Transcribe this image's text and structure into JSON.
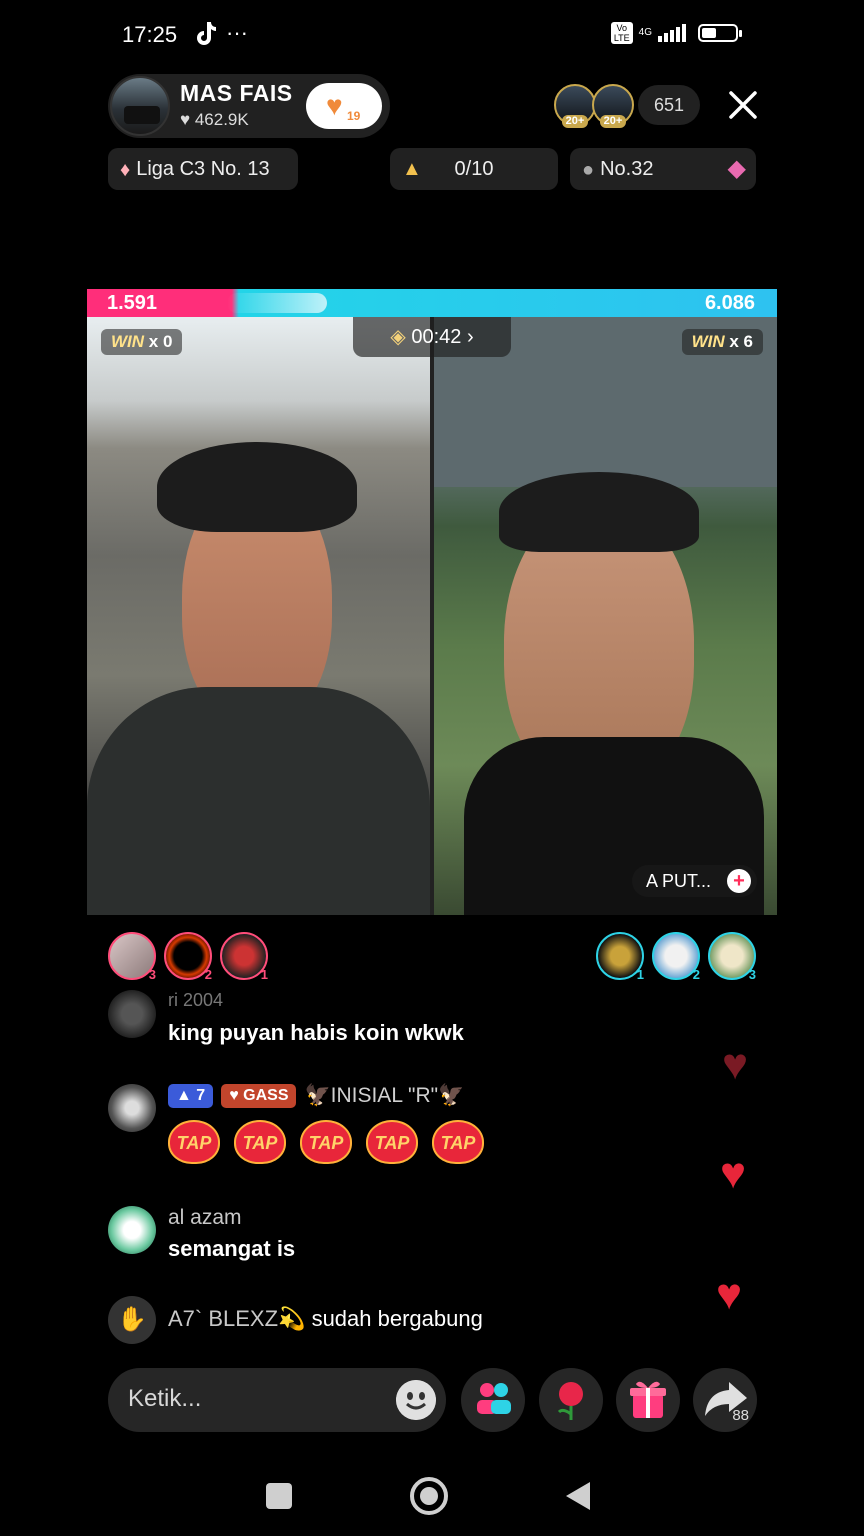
{
  "status_bar": {
    "time": "17:25",
    "more": "···",
    "network": "4G"
  },
  "host": {
    "name": "MAS FAIS",
    "likes": "462.9K",
    "fan_badge_count": "19"
  },
  "viewers": {
    "count": "651",
    "badges": [
      "20+",
      "20+"
    ]
  },
  "badges": {
    "league": "Liga C3 No. 13",
    "goal": "0/10",
    "rank": "No.32"
  },
  "battle": {
    "left_score": "1.591",
    "right_score": "6.086",
    "left_win_label": "WIN",
    "left_win_count": "x 0",
    "right_win_label": "WIN",
    "right_win_count": "x 6",
    "timer": "00:42",
    "guest_name": "A PUT..."
  },
  "gifters": {
    "left": [
      {
        "rank": "3"
      },
      {
        "rank": "2"
      },
      {
        "rank": "1"
      }
    ],
    "right": [
      {
        "rank": "1"
      },
      {
        "rank": "2"
      },
      {
        "rank": "3"
      }
    ]
  },
  "chat": [
    {
      "user": "ri 2004",
      "message": "king puyan habis koin wkwk"
    },
    {
      "level": "7",
      "fan_badge": "GASS",
      "user": "🦅INISIAL \"R\"🦅",
      "taps": [
        "TAP",
        "TAP",
        "TAP",
        "TAP",
        "TAP"
      ]
    },
    {
      "user": "al azam",
      "message": "semangat is"
    },
    {
      "user": "A7` BLEXZ💫",
      "message": "sudah bergabung"
    }
  ],
  "input": {
    "placeholder": "Ketik..."
  },
  "share_count": "88",
  "colors": {
    "left_team": "#ff2e7a",
    "right_team": "#23d4e8",
    "heart": "#e8263a"
  }
}
